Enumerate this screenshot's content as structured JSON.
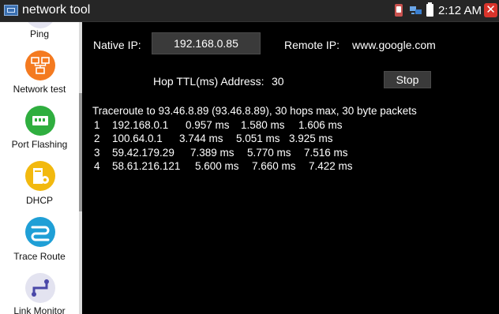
{
  "window": {
    "title": "network tool",
    "clock": "2:12 AM",
    "close_glyph": "✕"
  },
  "sidebar": {
    "items": [
      {
        "label": "Ping",
        "icon": "ping-icon",
        "color": "#e3e3f0"
      },
      {
        "label": "Network test",
        "icon": "network-test-icon",
        "color": "#f47a20"
      },
      {
        "label": "Port Flashing",
        "icon": "port-flashing-icon",
        "color": "#2fae3f"
      },
      {
        "label": "DHCP",
        "icon": "dhcp-icon",
        "color": "#f2b90f"
      },
      {
        "label": "Trace Route",
        "icon": "trace-route-icon",
        "color": "#1f9fd6"
      },
      {
        "label": "Link Monitor",
        "icon": "link-monitor-icon",
        "color": "#e3e3f0"
      }
    ]
  },
  "form": {
    "native_ip_label": "Native IP:",
    "native_ip_value": "192.168.0.85",
    "remote_ip_label": "Remote IP:",
    "remote_ip_value": "www.google.com",
    "hop_label": "Hop TTL(ms) Address:",
    "hop_value": "30",
    "stop_label": "Stop"
  },
  "trace": {
    "header": "Traceroute to 93.46.8.89 (93.46.8.89), 30 hops max, 30 byte packets",
    "hops": [
      {
        "n": "1",
        "addr": "192.168.0.1",
        "t1": "0.957 ms",
        "t2": "1.580 ms",
        "t3": "1.606 ms"
      },
      {
        "n": "2",
        "addr": "100.64.0.1",
        "t1": "3.744 ms",
        "t2": "5.051 ms",
        "t3": "3.925 ms"
      },
      {
        "n": "3",
        "addr": "59.42.179.29",
        "t1": "7.389 ms",
        "t2": "5.770 ms",
        "t3": "7.516 ms"
      },
      {
        "n": "4",
        "addr": "58.61.216.121",
        "t1": "5.600 ms",
        "t2": "7.660 ms",
        "t3": "7.422 ms"
      }
    ]
  },
  "colors": {
    "accent_orange": "#f47a20",
    "accent_green": "#2fae3f",
    "accent_yellow": "#f2b90f",
    "accent_blue": "#1f9fd6",
    "close_red": "#d9342b"
  }
}
